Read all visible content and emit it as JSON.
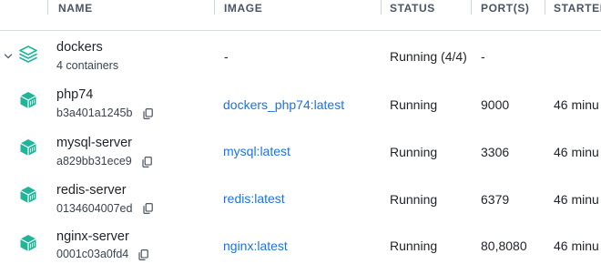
{
  "columns": {
    "name": "NAME",
    "image": "IMAGE",
    "status": "STATUS",
    "ports": "PORT(S)",
    "started": "STARTED"
  },
  "group": {
    "name": "dockers",
    "subtitle": "4 containers",
    "image": "-",
    "status": "Running (4/4)",
    "ports": "-"
  },
  "containers": [
    {
      "name": "php74",
      "id": "b3a401a1245b",
      "image": "dockers_php74:latest",
      "status": "Running",
      "ports": "9000",
      "started": "46 minu"
    },
    {
      "name": "mysql-server",
      "id": "a829bb31ece9",
      "image": "mysql:latest",
      "status": "Running",
      "ports": "3306",
      "started": "46 minu"
    },
    {
      "name": "redis-server",
      "id": "0134604007ed",
      "image": "redis:latest",
      "status": "Running",
      "ports": "6379",
      "started": "46 minu"
    },
    {
      "name": "nginx-server",
      "id": "0001c03a0fd4",
      "image": "nginx:latest",
      "status": "Running",
      "ports": "80,8080",
      "started": "46 minu"
    }
  ],
  "colors": {
    "container_icon": "#20b59a",
    "link": "#1a73e8"
  }
}
